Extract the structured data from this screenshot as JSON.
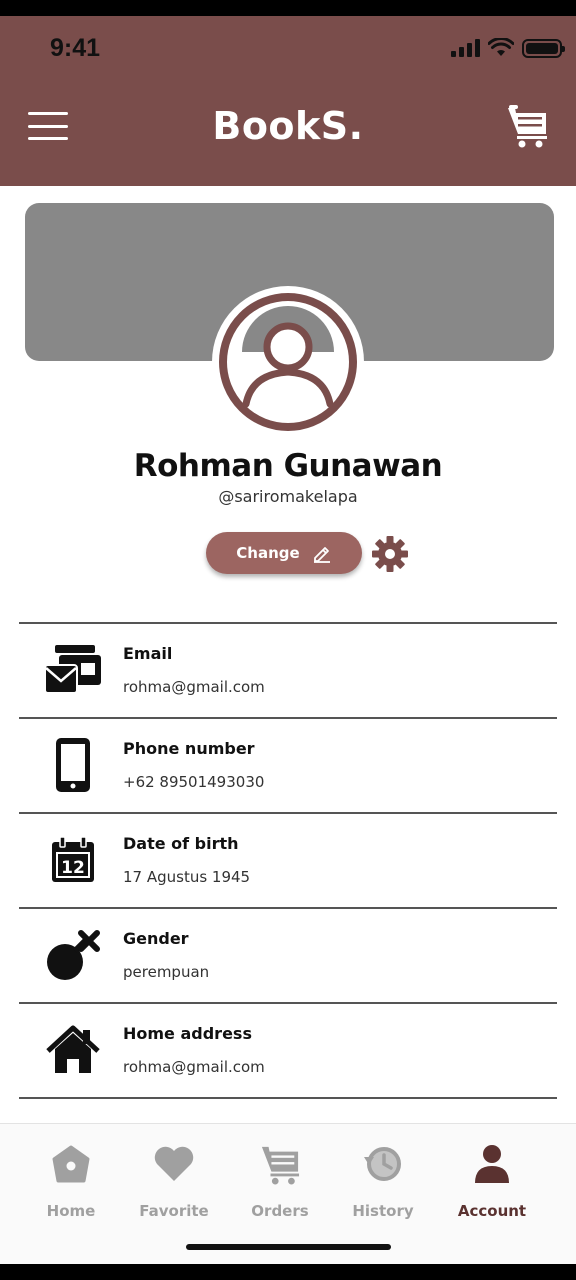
{
  "status_bar": {
    "time": "9:41"
  },
  "header": {
    "title": "BookS.",
    "menu_icon": "hamburger-menu-icon",
    "cart_icon": "cart-icon"
  },
  "profile": {
    "name": "Rohman Gunawan",
    "handle": "@sariromakelapa",
    "change_label": "Change",
    "edit_icon": "pencil-icon",
    "settings_icon": "gear-icon"
  },
  "info": [
    {
      "icon": "mail-icon",
      "label": "Email",
      "value": "rohma@gmail.com"
    },
    {
      "icon": "phone-icon",
      "label": "Phone number",
      "value": "+62 89501493030"
    },
    {
      "icon": "calendar-icon",
      "label": "Date of birth",
      "value": "17 Agustus 1945",
      "icon_text": "12"
    },
    {
      "icon": "gender-icon",
      "label": "Gender",
      "value": "perempuan"
    },
    {
      "icon": "home-icon",
      "label": "Home address",
      "value": "rohma@gmail.com"
    }
  ],
  "nav": [
    {
      "label": "Home",
      "icon": "home-icon",
      "active": false
    },
    {
      "label": "Favorite",
      "icon": "heart-icon",
      "active": false
    },
    {
      "label": "Orders",
      "icon": "cart-icon",
      "active": false
    },
    {
      "label": "History",
      "icon": "history-icon",
      "active": false
    },
    {
      "label": "Account",
      "icon": "account-icon",
      "active": true
    }
  ],
  "colors": {
    "brand": "#7a4d4b",
    "button": "#9c6561",
    "cover": "#888888",
    "nav_inactive": "#a0a0a0",
    "nav_active": "#5a3230"
  }
}
